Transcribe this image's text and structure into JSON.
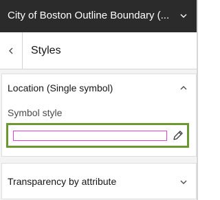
{
  "header": {
    "title": "City of Boston Outline Boundary (...",
    "chevron_icon": "chevron-down-icon"
  },
  "nav": {
    "back_icon": "chevron-left-icon",
    "title": "Styles"
  },
  "location": {
    "heading": "Location (Single symbol)",
    "chevron_icon": "chevron-up-icon",
    "symbol_style_label": "Symbol style",
    "symbol_color": "#e23fd5",
    "highlight_color": "#6a9a2f",
    "edit_icon": "pencil-icon"
  },
  "transparency": {
    "heading": "Transparency by attribute",
    "chevron_icon": "chevron-down-icon"
  }
}
